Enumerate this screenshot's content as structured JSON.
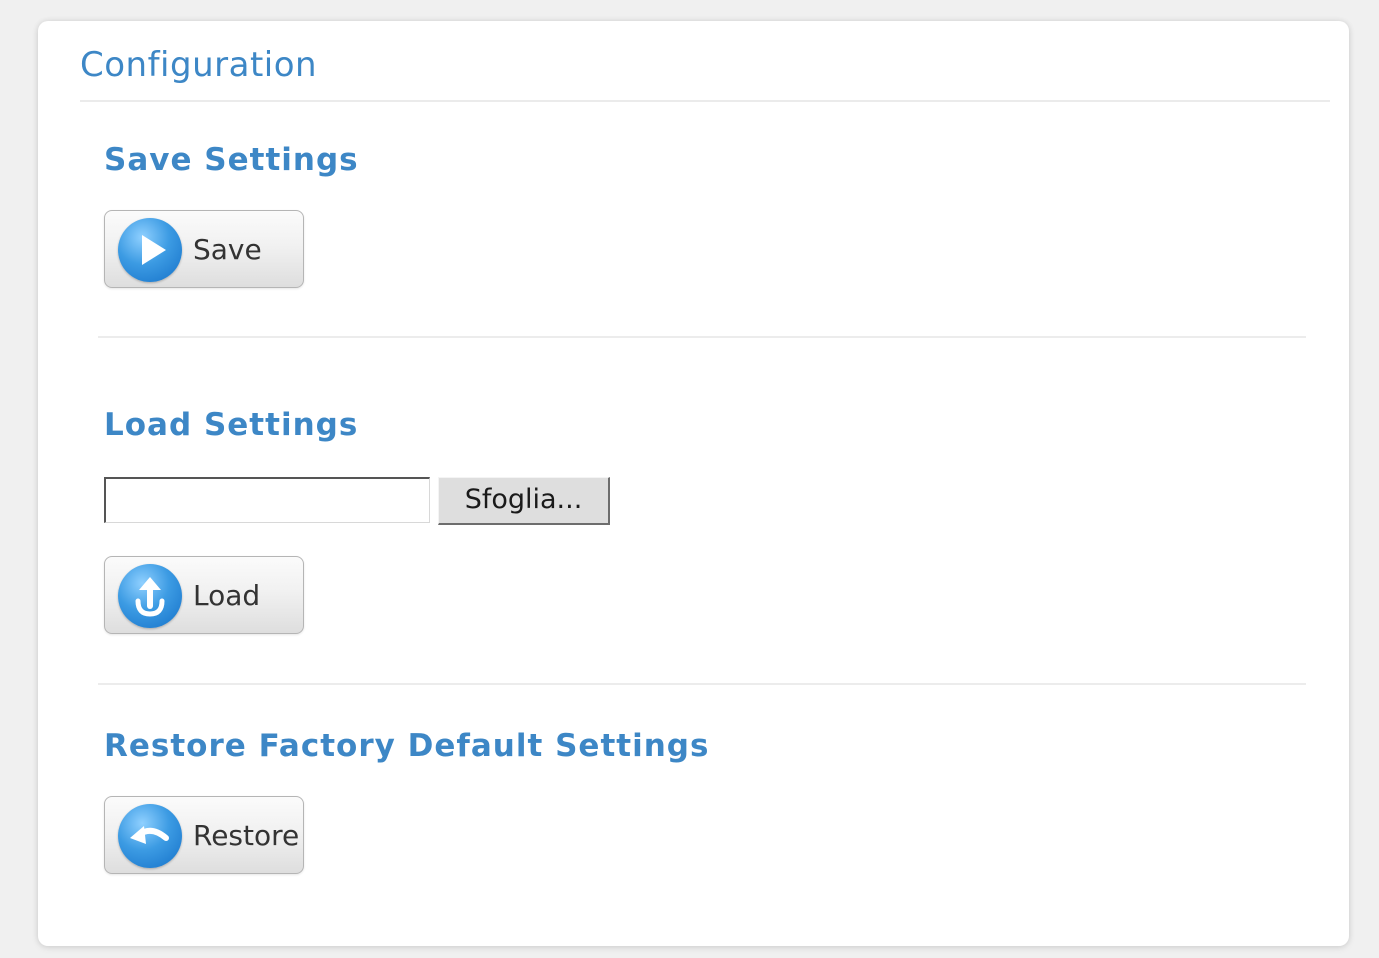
{
  "panel": {
    "title": "Configuration"
  },
  "save_section": {
    "title": "Save Settings",
    "button_label": "Save",
    "icon": "play-icon"
  },
  "load_section": {
    "title": "Load Settings",
    "file_value": "",
    "browse_label": "Sfoglia...",
    "button_label": "Load",
    "icon": "upload-icon"
  },
  "restore_section": {
    "title": "Restore Factory Default Settings",
    "button_label": "Restore",
    "icon": "undo-arrow-icon"
  },
  "colors": {
    "heading": "#3d87c6",
    "icon_blue": "#2a88d8"
  }
}
